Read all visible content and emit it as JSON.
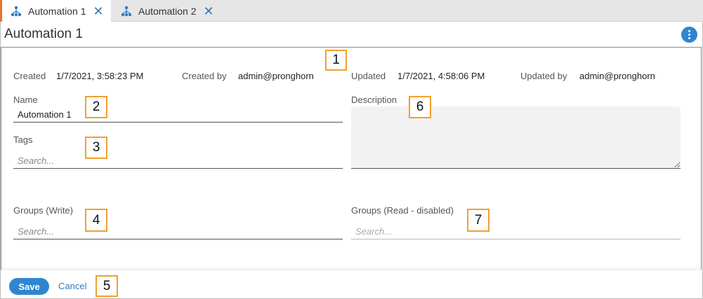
{
  "tabs": [
    {
      "label": "Automation 1",
      "icon": "automation-icon",
      "active": true
    },
    {
      "label": "Automation 2",
      "icon": "automation-icon",
      "active": false
    }
  ],
  "page": {
    "title": "Automation 1",
    "more_icon": "more-vertical-icon"
  },
  "meta": {
    "created_label": "Created",
    "created_value": "1/7/2021, 3:58:23 PM",
    "created_by_label": "Created by",
    "created_by_value": "admin@pronghorn",
    "updated_label": "Updated",
    "updated_value": "1/7/2021, 4:58:06 PM",
    "updated_by_label": "Updated by",
    "updated_by_value": "admin@pronghorn"
  },
  "form": {
    "name_label": "Name",
    "name_value": "Automation 1",
    "description_label": "Description",
    "tags_label": "Tags",
    "tags_placeholder": "Search...",
    "groups_write_label": "Groups (Write)",
    "groups_write_placeholder": "Search...",
    "groups_read_label": "Groups (Read - disabled)",
    "groups_read_placeholder": "Search..."
  },
  "footer": {
    "save_label": "Save",
    "cancel_label": "Cancel"
  },
  "callouts": [
    "1",
    "2",
    "3",
    "4",
    "5",
    "6",
    "7"
  ],
  "colors": {
    "accent": "#2f86cf",
    "tab_marker": "#e8732c",
    "callout_border": "#f0a030"
  }
}
